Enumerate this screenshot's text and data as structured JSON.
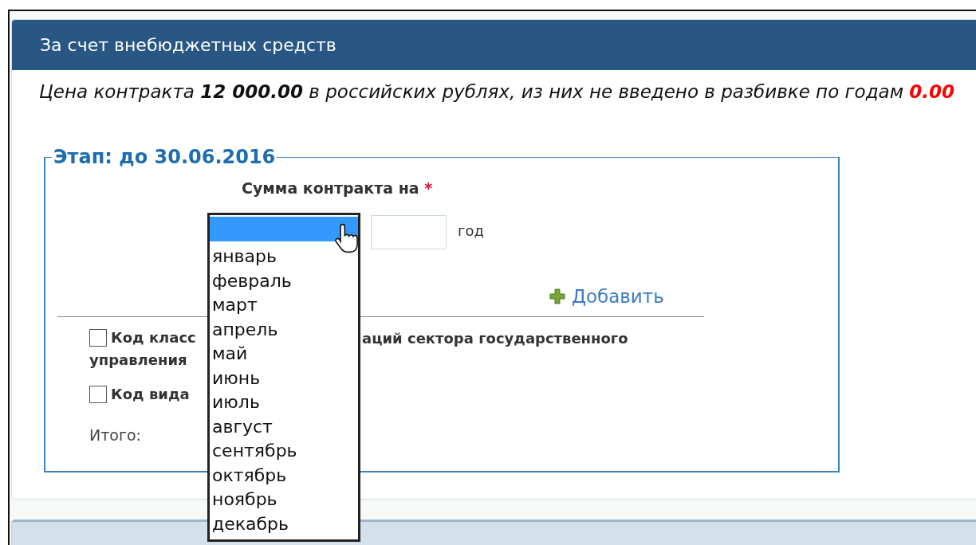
{
  "panel": {
    "title": "За счет внебюджетных средств"
  },
  "price": {
    "text": "Цена контракта **12 000.00** в российских рублях, из них не введено в разбивке по годам",
    "unallocated": "0.00"
  },
  "stage": {
    "legend": "Этап: до 30.06.2016",
    "sum_label": "Сумма контракта на",
    "required_mark": "*",
    "year_unit": "год",
    "add_link": "Добавить",
    "checkboxes": [
      {
        "parts": [
          "Код класс",
          "аций сектора государственного",
          "управления"
        ],
        "checked": false
      },
      {
        "parts": [
          "Код вида"
        ],
        "checked": false
      }
    ],
    "total_label": "Итого:"
  },
  "month_dropdown": {
    "blank_option": {
      "selected": true
    },
    "options": [
      {
        "label": "январь",
        "selected": false
      },
      {
        "label": "февраль",
        "selected": false
      },
      {
        "label": "март",
        "selected": false
      },
      {
        "label": "апрель",
        "selected": false
      },
      {
        "label": "май",
        "selected": false
      },
      {
        "label": "июнь",
        "selected": false
      },
      {
        "label": "июль",
        "selected": false
      },
      {
        "label": "август",
        "selected": false
      },
      {
        "label": "сентябрь",
        "selected": false
      },
      {
        "label": "октябрь",
        "selected": false
      },
      {
        "label": "ноябрь",
        "selected": false
      },
      {
        "label": "декабрь",
        "selected": false
      }
    ]
  }
}
